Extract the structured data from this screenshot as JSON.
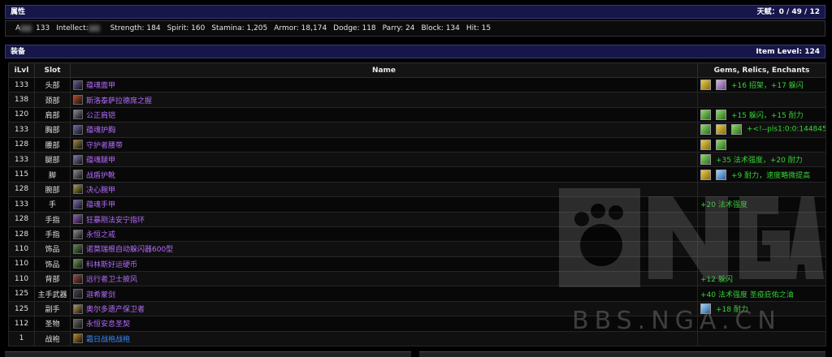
{
  "attributes": {
    "title": "属性",
    "talent": "天赋：0 / 49 / 12",
    "stats": [
      {
        "label": "A",
        "value": "133",
        "blurred": true
      },
      {
        "label": "Intellect:",
        "value": "",
        "blurred": true
      },
      {
        "label": "Strength:",
        "value": "184"
      },
      {
        "label": "Spirit:",
        "value": "160"
      },
      {
        "label": "Stamina:",
        "value": "1,205"
      },
      {
        "label": "Armor:",
        "value": "18,174"
      },
      {
        "label": "Dodge:",
        "value": "118"
      },
      {
        "label": "Parry:",
        "value": "24"
      },
      {
        "label": "Block:",
        "value": "134"
      },
      {
        "label": "Hit:",
        "value": "15"
      }
    ]
  },
  "equipment": {
    "title": "装备",
    "item_level": "Item Level: 124",
    "headers": {
      "ilvl": "iLvl",
      "slot": "Slot",
      "name": "Name",
      "gems": "Gems, Relics, Enchants"
    },
    "rows": [
      {
        "ilvl": "133",
        "slot": "头部",
        "name": "蕴魂面甲",
        "quality": "purple",
        "icon": "#6a5a9a",
        "gems": [
          "yellow",
          "pink"
        ],
        "ench": "+16 招架，+17 躲闪"
      },
      {
        "ilvl": "138",
        "slot": "颈部",
        "name": "斯洛泰萨拉德席之握",
        "quality": "purple",
        "icon": "#b04a2a",
        "gems": [],
        "ench": ""
      },
      {
        "ilvl": "120",
        "slot": "肩部",
        "name": "公正肩铠",
        "quality": "purple",
        "icon": "#8a8a9a",
        "gems": [
          "green",
          "green"
        ],
        "ench": "+15 躲闪，+15 耐力"
      },
      {
        "ilvl": "133",
        "slot": "胸部",
        "name": "蕴魂护胸",
        "quality": "purple",
        "icon": "#6a6aa8",
        "gems": [
          "green",
          "yellow",
          "green"
        ],
        "ench": "+<!--pls1:0:0:144845..."
      },
      {
        "ilvl": "128",
        "slot": "腰部",
        "name": "守护者腰带",
        "quality": "purple",
        "icon": "#a08a3a",
        "gems": [
          "yellow",
          "green"
        ],
        "ench": ""
      },
      {
        "ilvl": "133",
        "slot": "腿部",
        "name": "蕴魂腿甲",
        "quality": "purple",
        "icon": "#7a7ab0",
        "gems": [
          "green"
        ],
        "ench": "+35 法术强度，+20 耐力"
      },
      {
        "ilvl": "115",
        "slot": "脚",
        "name": "战盾护靴",
        "quality": "purple",
        "icon": "#8a8a8a",
        "gems": [
          "yellow",
          "blue"
        ],
        "ench": "+9 耐力，速度略微提高"
      },
      {
        "ilvl": "128",
        "slot": "腕部",
        "name": "决心腕甲",
        "quality": "purple",
        "icon": "#b09a4a",
        "gems": [],
        "ench": ""
      },
      {
        "ilvl": "133",
        "slot": "手",
        "name": "蕴魂手甲",
        "quality": "purple",
        "icon": "#7a6ab8",
        "gems": [],
        "ench": "+20 法术强度"
      },
      {
        "ilvl": "128",
        "slot": "手指",
        "name": "狂暴刚法安宁指环",
        "quality": "purple",
        "icon": "#9a5ac0",
        "gems": [],
        "ench": ""
      },
      {
        "ilvl": "128",
        "slot": "手指",
        "name": "永恒之戒",
        "quality": "purple",
        "icon": "#8a8a8a",
        "gems": [],
        "ench": ""
      },
      {
        "ilvl": "110",
        "slot": "饰品",
        "name": "诺莫瑞根自动躲闪器600型",
        "quality": "purple",
        "icon": "#5a8a4a",
        "gems": [],
        "ench": ""
      },
      {
        "ilvl": "110",
        "slot": "饰品",
        "name": "科林斯好运硬币",
        "quality": "purple",
        "icon": "#6a9a5a",
        "gems": [],
        "ench": ""
      },
      {
        "ilvl": "110",
        "slot": "背部",
        "name": "远行者卫士披风",
        "quality": "purple",
        "icon": "#9a4a3a",
        "gems": [],
        "ench": "+12 躲闪"
      },
      {
        "ilvl": "125",
        "slot": "主手武器",
        "name": "迦希蒙剑",
        "quality": "purple",
        "icon": "#4a4a5a",
        "gems": [],
        "ench": "+40 法术强度 圣疫庇佑之油"
      },
      {
        "ilvl": "125",
        "slot": "副手",
        "name": "奥尔多遗产保卫者",
        "quality": "purple",
        "icon": "#b09a5a",
        "gems": [
          "blue"
        ],
        "ench": "+18 耐力"
      },
      {
        "ilvl": "112",
        "slot": "圣物",
        "name": "永恒安息圣契",
        "quality": "purple",
        "icon": "#6a6a6a",
        "gems": [],
        "ench": ""
      },
      {
        "ilvl": "1",
        "slot": "战袍",
        "name": "霜日战袍战袍",
        "quality": "blue",
        "icon": "#c0862a",
        "gems": [],
        "ench": ""
      }
    ]
  },
  "watermark": {
    "text": "BBS.NGA.CN",
    "logo": "NGA"
  }
}
